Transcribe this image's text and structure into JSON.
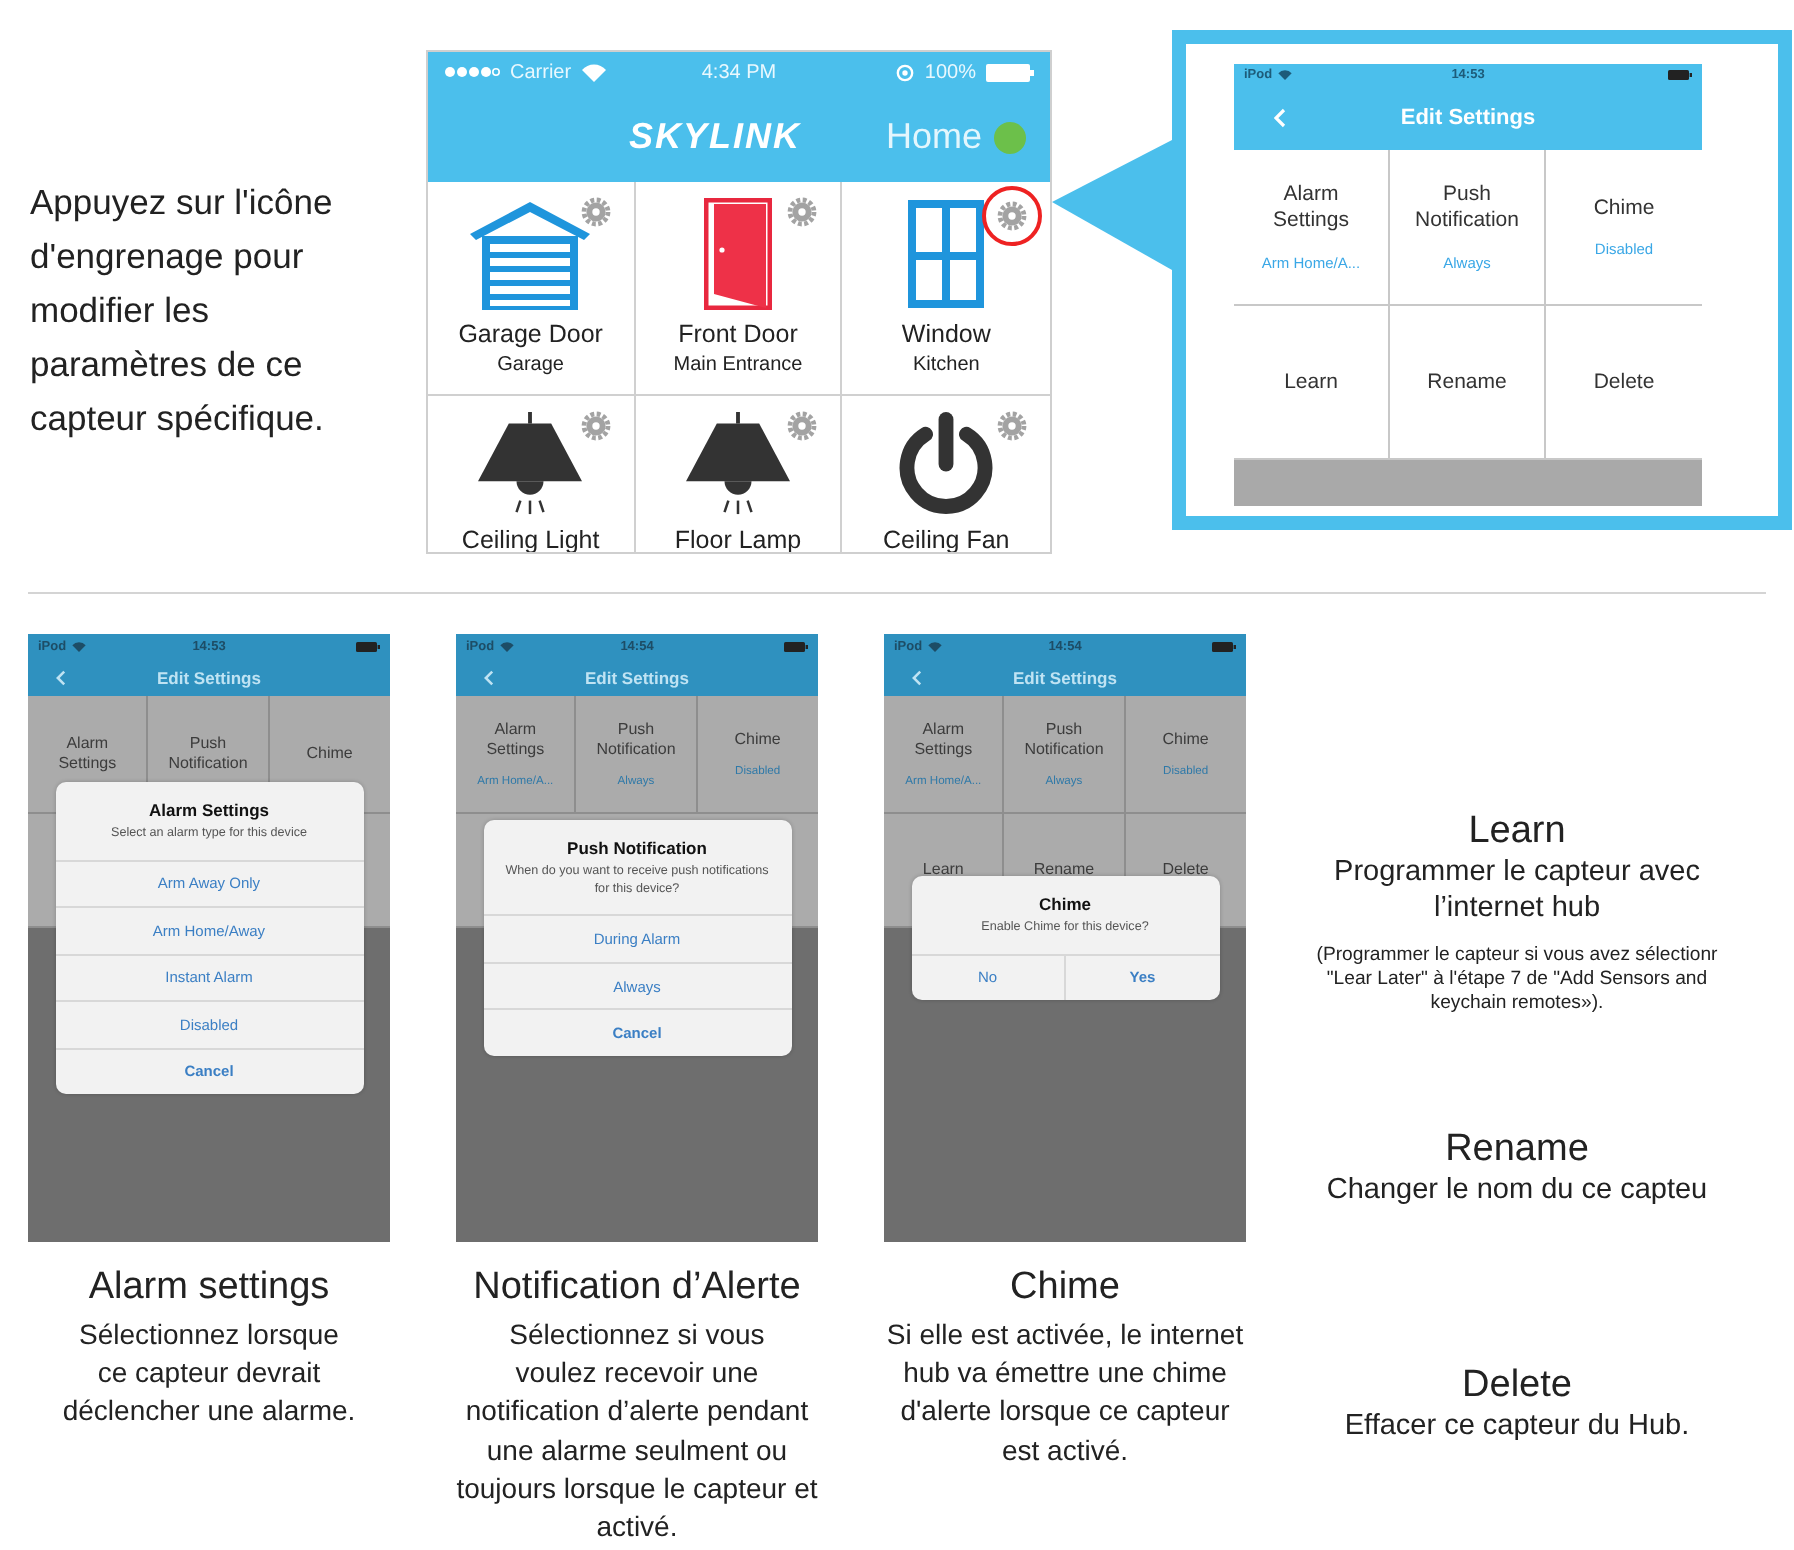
{
  "intro_text": "Appuyez sur l'icône d'engrenage pour modifier les paramètres de ce capteur spécifique.",
  "home_screen": {
    "status_bar": {
      "carrier": "Carrier",
      "time": "4:34 PM",
      "battery": "100%"
    },
    "logo": "SKYLINK",
    "location": "Home",
    "online": true,
    "devices": [
      {
        "name": "Garage Door",
        "room": "Garage",
        "kind": "garage",
        "highlighted": false
      },
      {
        "name": "Front Door",
        "room": "Main Entrance",
        "kind": "door",
        "highlighted": false
      },
      {
        "name": "Window",
        "room": "Kitchen",
        "kind": "window",
        "highlighted": true
      },
      {
        "name": "Ceiling Light",
        "kind": "lamp",
        "highlighted": false
      },
      {
        "name": "Floor Lamp",
        "kind": "lamp",
        "highlighted": false
      },
      {
        "name": "Ceiling Fan",
        "kind": "power",
        "highlighted": false
      }
    ]
  },
  "settings_callout": {
    "status_bar": {
      "device": "iPod",
      "time": "14:53"
    },
    "title": "Edit Settings",
    "options": [
      {
        "label": "Alarm Settings",
        "value": "Arm Home/A..."
      },
      {
        "label": "Push Notification",
        "value": "Always"
      },
      {
        "label": "Chime",
        "value": "Disabled"
      },
      {
        "label": "Learn"
      },
      {
        "label": "Rename"
      },
      {
        "label": "Delete"
      }
    ]
  },
  "examples": [
    {
      "screen": {
        "status_bar": {
          "device": "iPod",
          "time": "14:53"
        },
        "title": "Edit Settings",
        "options": [
          {
            "label": "Alarm Settings"
          },
          {
            "label": "Push Notification"
          },
          {
            "label": "Chime"
          }
        ],
        "dialog": {
          "kind": "stacked",
          "title": "Alarm Settings",
          "message": "Select an alarm type for this device",
          "actions": [
            {
              "label": "Arm Away Only",
              "bold": false
            },
            {
              "label": "Arm Home/Away",
              "bold": false
            },
            {
              "label": "Instant Alarm",
              "bold": false
            },
            {
              "label": "Disabled",
              "bold": false
            },
            {
              "label": "Cancel",
              "bold": true
            }
          ]
        }
      },
      "caption": {
        "title": "Alarm settings",
        "lines": [
          "Sélectionnez lorsque",
          "ce capteur devrait",
          "déclencher une alarme."
        ]
      }
    },
    {
      "screen": {
        "status_bar": {
          "device": "iPod",
          "time": "14:54"
        },
        "title": "Edit Settings",
        "options": [
          {
            "label": "Alarm Settings",
            "value": "Arm Home/A..."
          },
          {
            "label": "Push Notification",
            "value": "Always"
          },
          {
            "label": "Chime",
            "value": "Disabled"
          }
        ],
        "dialog": {
          "kind": "stacked",
          "title": "Push Notification",
          "message": "When do you want to receive push notifications for this device?",
          "actions": [
            {
              "label": "During Alarm",
              "bold": false
            },
            {
              "label": "Always",
              "bold": false
            },
            {
              "label": "Cancel",
              "bold": true
            }
          ]
        }
      },
      "caption": {
        "title": "Notification d’Alerte",
        "lines": [
          "Sélectionnez si vous",
          "voulez recevoir une",
          "notification d’alerte pendant",
          "une alarme seulment ou",
          "toujours lorsque le capteur et",
          "activé."
        ]
      }
    },
    {
      "screen": {
        "status_bar": {
          "device": "iPod",
          "time": "14:54"
        },
        "title": "Edit Settings",
        "options": [
          {
            "label": "Alarm Settings",
            "value": "Arm Home/A..."
          },
          {
            "label": "Push Notification",
            "value": "Always"
          },
          {
            "label": "Chime",
            "value": "Disabled"
          },
          {
            "label": "Learn"
          },
          {
            "label": "Rename"
          },
          {
            "label": "Delete"
          }
        ],
        "dialog": {
          "kind": "row",
          "title": "Chime",
          "message": "Enable Chime for this device?",
          "actions": [
            {
              "label": "No",
              "bold": false
            },
            {
              "label": "Yes",
              "bold": true
            }
          ]
        }
      },
      "caption": {
        "title": "Chime",
        "lines": [
          "Si elle est activée, le internet",
          "hub va émettre une chime",
          "d'alerte lorsque ce capteur",
          "est activé."
        ]
      }
    }
  ],
  "side_notes": [
    {
      "title": "Learn",
      "lines": [
        "Programmer le capteur avec",
        "l’internet hub"
      ],
      "note_lines": [
        "(Programmer le capteur si vous avez sélectionr",
        "\"Lear Later\" à l'étape 7 de \"Add Sensors and",
        "keychain remotes»)."
      ]
    },
    {
      "title": "Rename",
      "lines": [
        "Changer le nom du ce capteu"
      ]
    },
    {
      "title": "Delete",
      "lines": [
        "Effacer ce capteur du Hub."
      ]
    }
  ]
}
